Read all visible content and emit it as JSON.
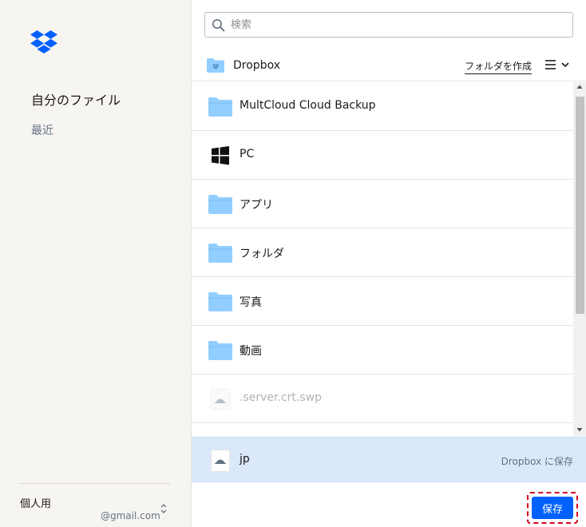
{
  "sidebar": {
    "nav_primary": "自分のファイル",
    "nav_secondary": "最近",
    "account_type": "個人用",
    "account_email": "@gmail.com"
  },
  "search": {
    "placeholder": "検索",
    "value": ""
  },
  "header": {
    "location": "Dropbox",
    "create_folder": "フォルダを作成"
  },
  "items": [
    {
      "label": "MultCloud Cloud Backup",
      "icon": "folder-icon"
    },
    {
      "label": "PC",
      "icon": "windows-icon"
    },
    {
      "label": "アプリ",
      "icon": "folder-icon"
    },
    {
      "label": "フォルダ",
      "icon": "folder-icon"
    },
    {
      "label": "写真",
      "icon": "folder-icon"
    },
    {
      "label": "動画",
      "icon": "folder-icon"
    },
    {
      "label": ".server.crt.swp",
      "icon": "file-icon",
      "disabled": true
    }
  ],
  "selected": {
    "label": "jp",
    "hint": "Dropbox に保存",
    "icon": "file-icon"
  },
  "footer": {
    "save_label": "保存"
  },
  "colors": {
    "accent": "#0061fe",
    "folder": "#92ceff",
    "selection": "#dbe8fc",
    "highlight_border": "#d0021b"
  }
}
